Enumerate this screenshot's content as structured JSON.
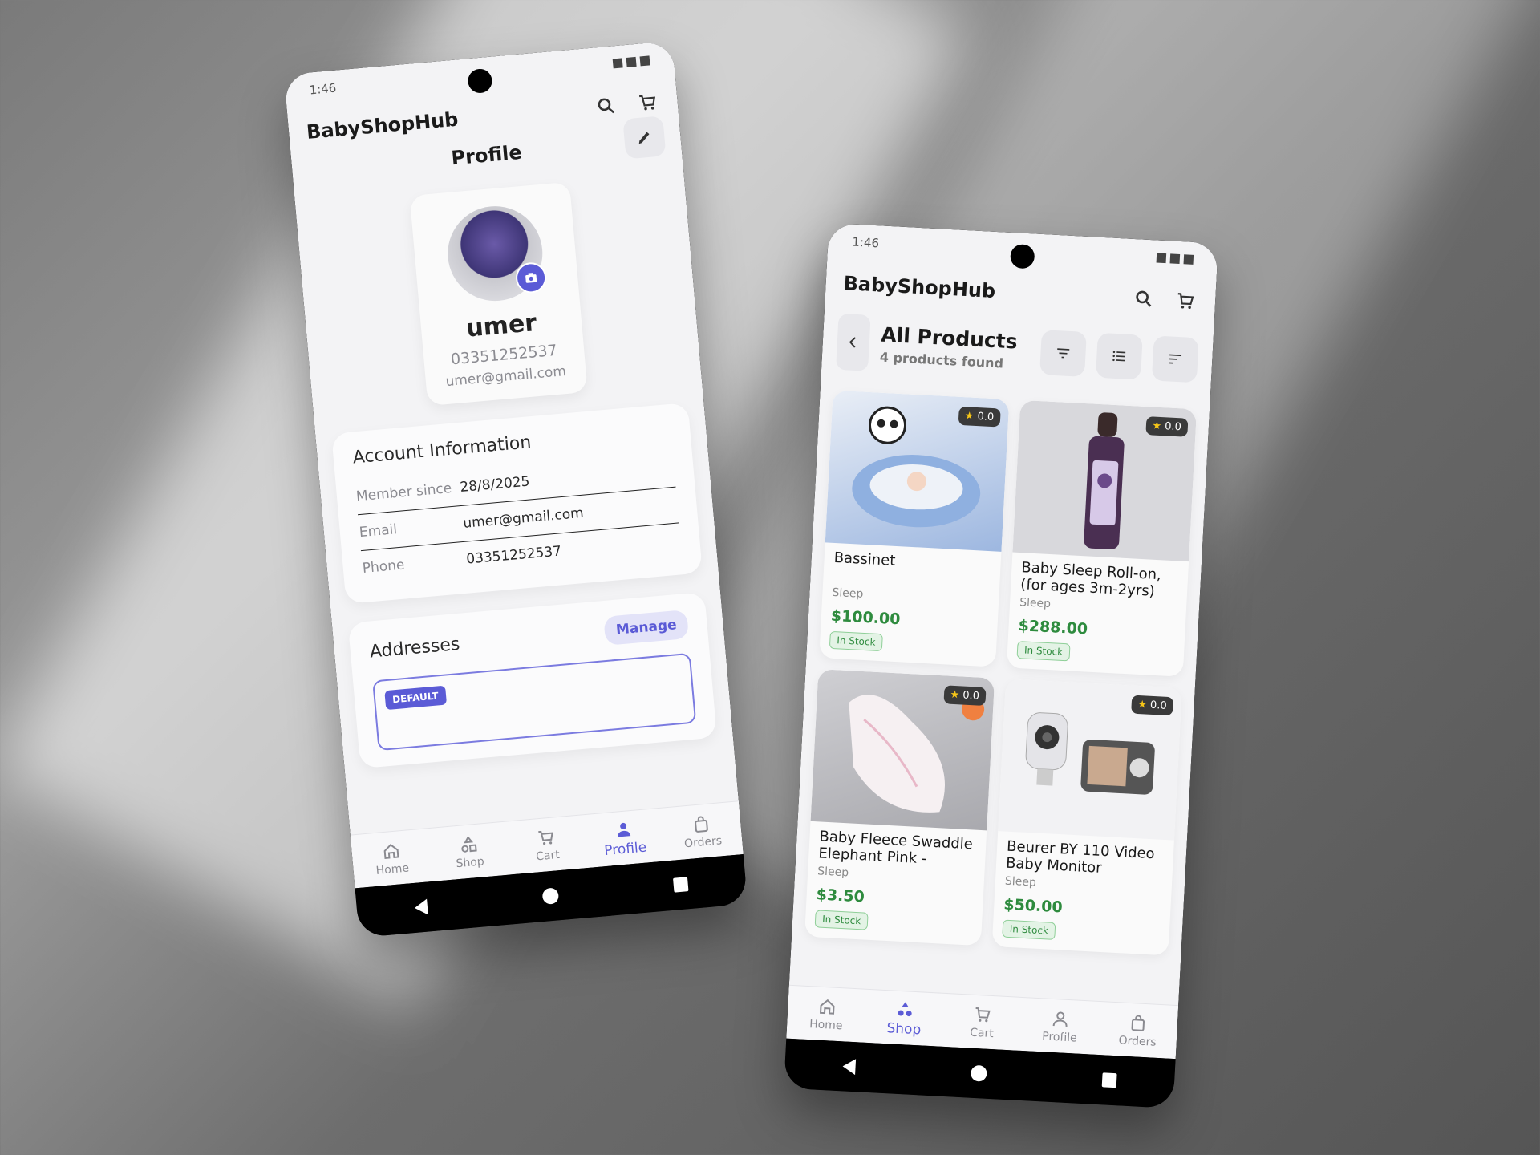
{
  "status": {
    "time": "1:46"
  },
  "app": {
    "brand": "BabyShopHub"
  },
  "profile_screen": {
    "title": "Profile",
    "user": {
      "name": "umer",
      "phone": "03351252537",
      "email": "umer@gmail.com"
    },
    "account": {
      "heading": "Account Information",
      "rows": [
        {
          "label": "Member since",
          "value": "28/8/2025"
        },
        {
          "label": "Email",
          "value": "umer@gmail.com"
        },
        {
          "label": "Phone",
          "value": "03351252537"
        }
      ]
    },
    "addresses": {
      "heading": "Addresses",
      "manage_label": "Manage",
      "default_tag": "DEFAULT"
    }
  },
  "shop_screen": {
    "title": "All Products",
    "subtitle": "4 products found",
    "products": [
      {
        "name": "Bassinet",
        "category": "Sleep",
        "price": "$100.00",
        "stock": "In Stock",
        "rating": "0.0"
      },
      {
        "name": "Baby Sleep Roll-on, (for ages 3m-2yrs)",
        "category": "Sleep",
        "price": "$288.00",
        "stock": "In Stock",
        "rating": "0.0"
      },
      {
        "name": "Baby Fleece Swaddle Elephant Pink -",
        "category": "Sleep",
        "price": "$3.50",
        "stock": "In Stock",
        "rating": "0.0"
      },
      {
        "name": "Beurer BY 110 Video Baby Monitor",
        "category": "Sleep",
        "price": "$50.00",
        "stock": "In Stock",
        "rating": "0.0"
      }
    ]
  },
  "nav": {
    "items": [
      {
        "label": "Home",
        "icon": "home-icon"
      },
      {
        "label": "Shop",
        "icon": "shapes-icon"
      },
      {
        "label": "Cart",
        "icon": "cart-icon"
      },
      {
        "label": "Profile",
        "icon": "person-icon"
      },
      {
        "label": "Orders",
        "icon": "bag-icon"
      }
    ]
  },
  "colors": {
    "accent": "#5b5bd6",
    "price": "#2e8b3e",
    "background": "#f3f3f5"
  }
}
